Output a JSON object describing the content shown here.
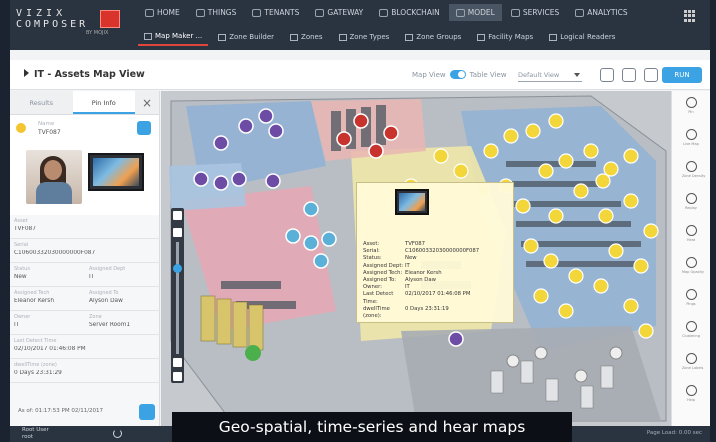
{
  "app": {
    "logo_line1": "VIZIX",
    "logo_line2": "COMPOSER",
    "logo_line3": "BY MOJIX"
  },
  "main_nav": [
    {
      "label": "HOME",
      "icon": "home-icon"
    },
    {
      "label": "THINGS",
      "icon": "things-icon"
    },
    {
      "label": "TENANTS",
      "icon": "tenants-icon"
    },
    {
      "label": "GATEWAY",
      "icon": "gateway-icon"
    },
    {
      "label": "BLOCKCHAIN",
      "icon": "blockchain-icon"
    },
    {
      "label": "MODEL",
      "icon": "model-icon",
      "active": true
    },
    {
      "label": "SERVICES",
      "icon": "services-icon"
    },
    {
      "label": "ANALYTICS",
      "icon": "analytics-icon"
    }
  ],
  "sub_nav": [
    {
      "label": "Map Maker ...",
      "active": true
    },
    {
      "label": "Zone Builder"
    },
    {
      "label": "Zones"
    },
    {
      "label": "Zone Types"
    },
    {
      "label": "Zone Groups"
    },
    {
      "label": "Facility Maps"
    },
    {
      "label": "Logical Readers"
    }
  ],
  "view": {
    "title": "IT - Assets Map View",
    "map_view_label": "Map View",
    "table_view_label": "Table View",
    "view_select": "Default View",
    "run_label": "RUN"
  },
  "panel": {
    "tab_results": "Results",
    "tab_pin_info": "Pin Info",
    "close_label": "×",
    "name_label": "Name",
    "name_value": "TVF087",
    "fields": [
      [
        {
          "label": "Asset",
          "value": "TVF087"
        }
      ],
      [
        {
          "label": "Serial",
          "value": "C10600332030000000F087"
        }
      ],
      [
        {
          "label": "Status",
          "value": "New"
        },
        {
          "label": "Assigned Dept",
          "value": "IT"
        }
      ],
      [
        {
          "label": "Assigned Tech",
          "value": "Eleanor Kersh"
        },
        {
          "label": "Assigned To",
          "value": "Alyson Daw"
        }
      ],
      [
        {
          "label": "Owner",
          "value": "IT"
        },
        {
          "label": "Zone",
          "value": "Server Room1"
        }
      ],
      [
        {
          "label": "Last Detect Time",
          "value": "02/10/2017 01:46:08 PM"
        }
      ],
      [
        {
          "label": "dwellTime (zone)",
          "value": "0 Days 23:31:29"
        }
      ]
    ],
    "as_of": "As of: 01:17:53 PM 02/11/2017"
  },
  "popup": {
    "rows": [
      {
        "k": "Asset:",
        "v": "TVF087"
      },
      {
        "k": "Serial:",
        "v": "C10600332030000000F087"
      },
      {
        "k": "Status:",
        "v": "New"
      },
      {
        "k": "Assigned Dept:",
        "v": "IT"
      },
      {
        "k": "Assigned Tech:",
        "v": "Eleanor Kersh"
      },
      {
        "k": "Assigned To:",
        "v": "Alyson Daw"
      },
      {
        "k": "Owner:",
        "v": "IT"
      },
      {
        "k": "Last Detect Time:",
        "v": "02/10/2017 01:46:08 PM"
      },
      {
        "k": "dwellTime (zone):",
        "v": "0 Days 23:31:19"
      }
    ]
  },
  "right_tools": [
    {
      "label": "Pin",
      "icon": "pin-icon"
    },
    {
      "label": "Live Map",
      "icon": "live-map-icon"
    },
    {
      "label": "Zone Density",
      "icon": "zone-density-icon"
    },
    {
      "label": "Replay",
      "icon": "replay-icon"
    },
    {
      "label": "Heat",
      "icon": "heat-icon"
    },
    {
      "label": "Map Opacity",
      "icon": "opacity-icon"
    },
    {
      "label": "Pings",
      "icon": "pings-icon"
    },
    {
      "label": "Clustering",
      "icon": "clustering-icon"
    },
    {
      "label": "Zone Labels",
      "icon": "zone-labels-icon"
    },
    {
      "label": "Help",
      "icon": "help-icon"
    }
  ],
  "footer": {
    "user_name": "Root User",
    "user_role": "root",
    "page_load": "Page Load: 0.00 sec"
  },
  "caption": "Geo-spatial, time-series and hear maps",
  "colors": {
    "accent": "#3ba3e3",
    "brand_red": "#d9342b",
    "pin_yellow": "#f3d63a",
    "pin_purple": "#6d4ca6",
    "pin_red": "#c8332e",
    "pin_teal": "#5bb0d8",
    "zone_blue": "#8fb1d6",
    "zone_pink": "#e6a7b5",
    "zone_yellow": "#f0e7a8"
  }
}
